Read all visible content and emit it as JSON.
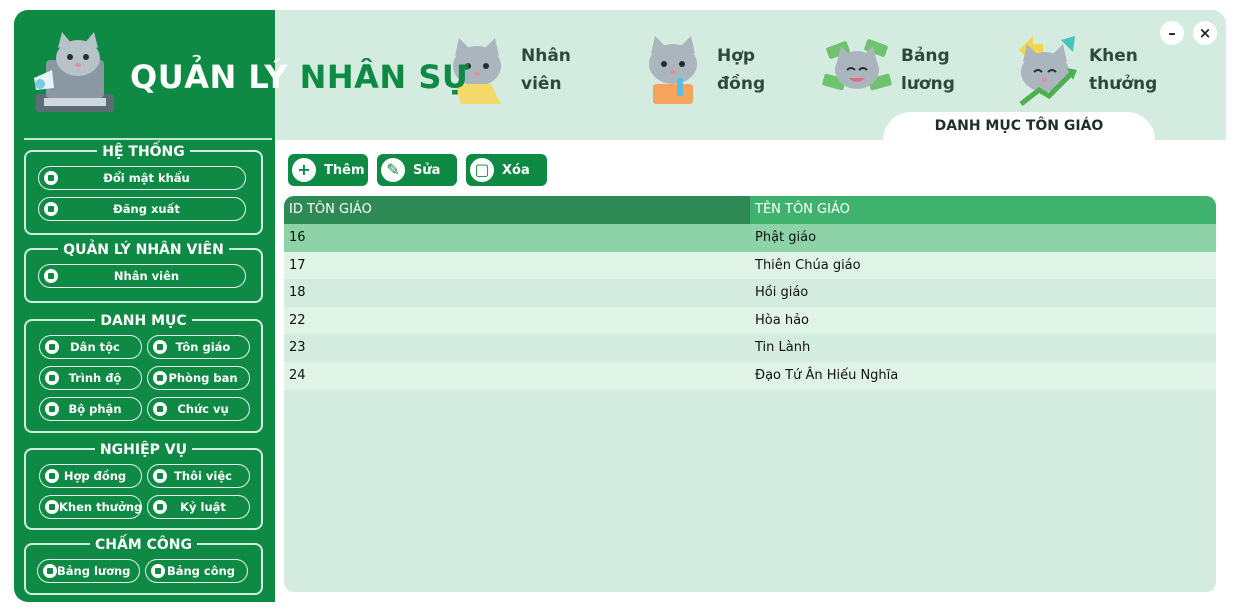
{
  "app": {
    "title_part1": "QUẢN LÝ ",
    "title_part2": "NHÂN SỰ"
  },
  "window_controls": {
    "minimize": "–",
    "close": "×"
  },
  "nav": [
    {
      "line1": "Nhân",
      "line2": "viên",
      "icon": "cat-laptop-icon"
    },
    {
      "line1": "Hợp",
      "line2": "đồng",
      "icon": "cat-contract-icon"
    },
    {
      "line1": "Bảng",
      "line2": "lương",
      "icon": "cat-money-icon"
    },
    {
      "line1": "Khen",
      "line2": "thưởng",
      "icon": "cat-reward-icon"
    }
  ],
  "section_caption": "DANH MỤC TÔN GIÁO",
  "sidebar": {
    "he_thong": {
      "title": "HỆ THỐNG",
      "items": [
        "Đổi mật khẩu",
        "Đăng xuất"
      ]
    },
    "quan_ly_nv": {
      "title": "QUẢN LÝ NHÂN VIÊN",
      "items": [
        "Nhân viên"
      ]
    },
    "danh_muc": {
      "title": "DANH MỤC",
      "items": [
        "Dân tộc",
        "Tôn giáo",
        "Trình độ",
        "Phòng ban",
        "Bộ phận",
        "Chức vụ"
      ]
    },
    "nghiep_vu": {
      "title": "NGHIỆP VỤ",
      "items": [
        "Hợp đồng",
        "Thôi việc",
        "Khen thưởng",
        "Kỷ luật"
      ]
    },
    "cham_cong": {
      "title": "CHẤM CÔNG",
      "items": [
        "Bảng lương",
        "Bảng công"
      ]
    }
  },
  "actions": {
    "add": "Thêm",
    "edit": "Sửa",
    "delete": "Xóa"
  },
  "table": {
    "columns": [
      "ID TÔN GIÁO",
      "TÊN TÔN GIÁO"
    ],
    "rows": [
      {
        "id": "16",
        "name": "Phật giáo"
      },
      {
        "id": "17",
        "name": "Thiên Chúa giáo"
      },
      {
        "id": "18",
        "name": "Hồi giáo"
      },
      {
        "id": "22",
        "name": "Hòa hảo"
      },
      {
        "id": "23",
        "name": "Tin Lành"
      },
      {
        "id": "24",
        "name": "Đạo Tứ Ân Hiếu Nghĩa"
      }
    ],
    "selected_row": 0
  },
  "colors": {
    "primary": "#0e8a45",
    "background": "#d4ecdf",
    "header_dark": "#2d8a54",
    "header_light": "#3fb36d",
    "row_selected": "#8ed2a8",
    "row_alt": "#e0f3e7"
  }
}
